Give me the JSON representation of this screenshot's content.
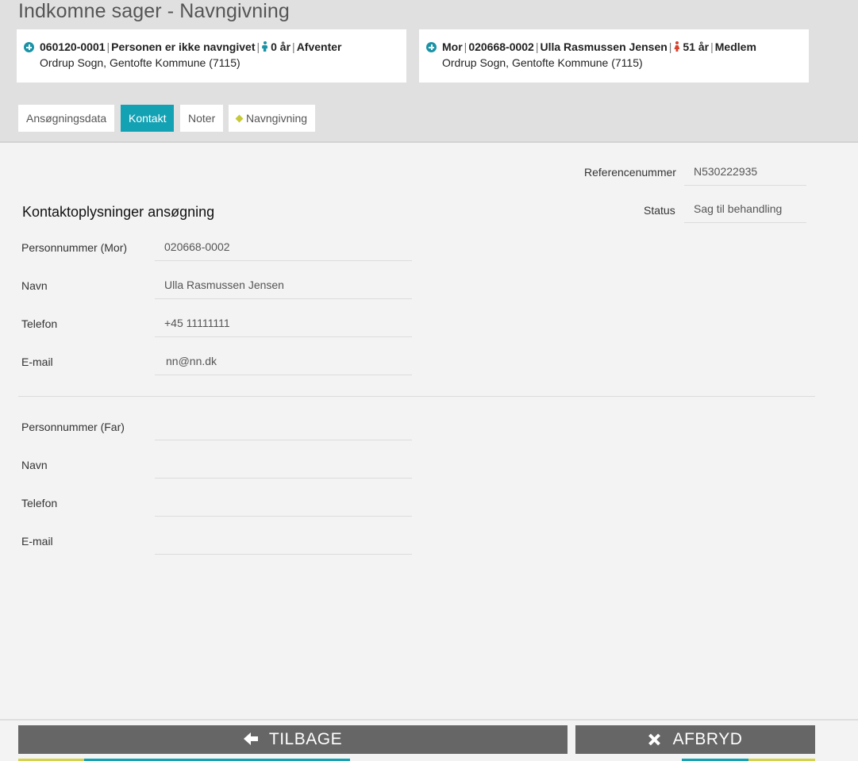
{
  "page_title": "Indkomne sager - Navngivning",
  "card_child": {
    "id": "060120-0001",
    "name": "Personen er ikke navngivet",
    "age": "0 år",
    "status": "Afventer",
    "location": "Ordrup Sogn, Gentofte Kommune (7115)"
  },
  "card_mother": {
    "role": "Mor",
    "id": "020668-0002",
    "name": "Ulla Rasmussen Jensen",
    "age": "51 år",
    "status": "Medlem",
    "location": "Ordrup Sogn, Gentofte Kommune (7115)"
  },
  "separator": "|",
  "tabs": [
    {
      "label": "Ansøgningsdata"
    },
    {
      "label": "Kontakt"
    },
    {
      "label": "Noter"
    },
    {
      "label": "Navngivning"
    }
  ],
  "reference": {
    "label": "Referencenummer",
    "value": "N530222935"
  },
  "status": {
    "label": "Status",
    "value": "Sag til behandling"
  },
  "section_title": "Kontaktoplysninger ansøgning",
  "mother_contact": {
    "cpr_label": "Personnummer (Mor)",
    "cpr_value": "020668-0002",
    "name_label": "Navn",
    "name_value": "Ulla Rasmussen Jensen",
    "phone_label": "Telefon",
    "phone_value": "+45 11111111",
    "email_label": "E-mail",
    "email_value": "nn@nn.dk"
  },
  "father_contact": {
    "cpr_label": "Personnummer (Far)",
    "cpr_value": "",
    "name_label": "Navn",
    "name_value": "",
    "phone_label": "Telefon",
    "phone_value": "",
    "email_label": "E-mail",
    "email_value": ""
  },
  "buttons": {
    "back": "TILBAGE",
    "cancel": "AFBRYD"
  },
  "colors": {
    "accent": "#13a2b4",
    "button": "#666666",
    "male": "#1a93a6",
    "female": "#d9412b",
    "underline_yellow": "#d4d24a"
  }
}
